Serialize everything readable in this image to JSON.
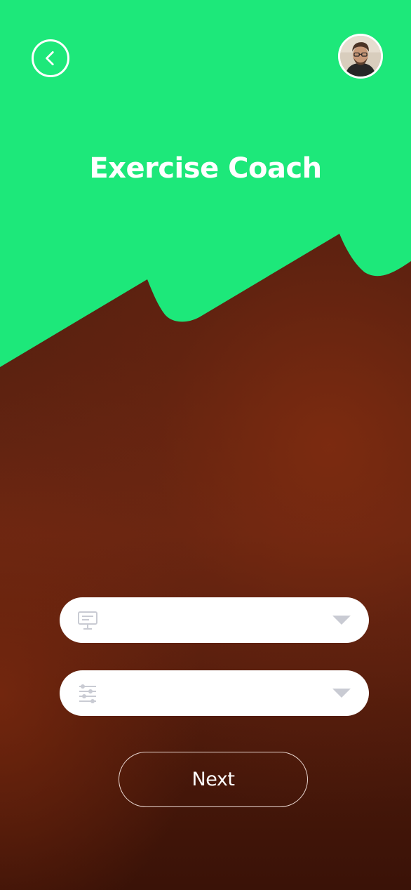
{
  "header": {
    "title": "Exercise Coach",
    "back_icon": "chevron-left-icon",
    "avatar_icon": "user-avatar"
  },
  "form": {
    "fields": [
      {
        "icon": "monitor-icon",
        "value": "",
        "control": "dropdown"
      },
      {
        "icon": "sliders-icon",
        "value": "",
        "control": "dropdown"
      }
    ]
  },
  "actions": {
    "next_label": "Next"
  },
  "colors": {
    "accent_green": "#1de87a",
    "background_brown": "#5a2110",
    "field_background": "#ffffff",
    "icon_gray": "#c9cbd3"
  }
}
